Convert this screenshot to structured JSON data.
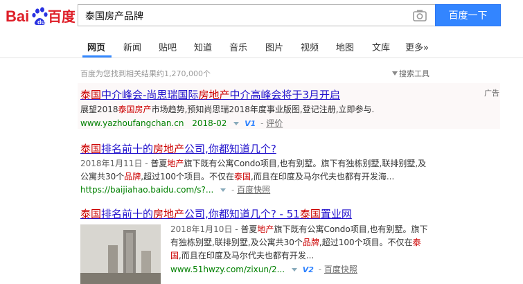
{
  "header": {
    "logo_text_left": "Bai",
    "logo_text_right": "百度",
    "query": "泰国房产品牌",
    "search_button": "百度一下"
  },
  "nav": {
    "items": [
      "网页",
      "新闻",
      "贴吧",
      "知道",
      "音乐",
      "图片",
      "视频",
      "地图",
      "文库",
      "更多»"
    ],
    "active": "网页"
  },
  "results_info": {
    "count_text": "百度为您找到相关结果约1,270,000个",
    "tools_label": "搜索工具"
  },
  "ad": {
    "label": "广告",
    "title_parts": [
      {
        "t": "泰国",
        "hl": true
      },
      {
        "t": "中介峰会-尚思瑞国际",
        "hl": false
      },
      {
        "t": "房地产",
        "hl": true
      },
      {
        "t": "中介高峰会将于3月开启",
        "hl": false
      }
    ],
    "abstract_parts": [
      {
        "t": "展望2018",
        "hl": false
      },
      {
        "t": "泰国房产",
        "hl": true
      },
      {
        "t": "市场趋势,预知尚思瑞2018年度事业版图,登记注册,立即参与.",
        "hl": false
      }
    ],
    "url": "www.yazhoufangchan.cn",
    "date": "2018-02",
    "badge": "V1",
    "eval": "评价"
  },
  "results": [
    {
      "title_parts": [
        {
          "t": "泰国",
          "hl": true
        },
        {
          "t": "排名前十的",
          "hl": false
        },
        {
          "t": "房地产",
          "hl": true
        },
        {
          "t": "公司,你都知道几个?",
          "hl": false
        }
      ],
      "line1_parts": [
        {
          "t": "2018年1月11日 - ",
          "hl": false,
          "date": true
        },
        {
          "t": "普夏",
          "hl": false
        },
        {
          "t": "地产",
          "hl": true
        },
        {
          "t": "旗下既有公寓Condo项目,也有别墅。旗下有独栋别墅,联排别墅,及",
          "hl": false
        }
      ],
      "line2_parts": [
        {
          "t": "公寓共30个",
          "hl": false
        },
        {
          "t": "品牌",
          "hl": true
        },
        {
          "t": ",超过100个项目。不仅在",
          "hl": false
        },
        {
          "t": "泰国",
          "hl": true
        },
        {
          "t": ",而且在印度及马尔代夫也都有开发海...",
          "hl": false
        }
      ],
      "url": "https://baijiahao.baidu.com/s?...",
      "cache": "百度快照"
    },
    {
      "title_parts": [
        {
          "t": "泰国",
          "hl": true
        },
        {
          "t": "排名前十的",
          "hl": false
        },
        {
          "t": "房地产",
          "hl": true
        },
        {
          "t": "公司,你都知道几个? - 51",
          "hl": false
        },
        {
          "t": "泰国",
          "hl": true
        },
        {
          "t": "置业网",
          "hl": false
        }
      ],
      "line1_parts": [
        {
          "t": "2018年1月10日 - ",
          "hl": false,
          "date": true
        },
        {
          "t": "普夏",
          "hl": false
        },
        {
          "t": "地产",
          "hl": true
        },
        {
          "t": "旗下既有公寓Condo项目,也有别墅。旗下",
          "hl": false
        }
      ],
      "line2_parts": [
        {
          "t": "有独栋别墅,联排别墅,及公寓共30个",
          "hl": false
        },
        {
          "t": "品牌",
          "hl": true
        },
        {
          "t": ",超过100个项目。不仅在",
          "hl": false
        },
        {
          "t": "泰",
          "hl": true
        }
      ],
      "line3_parts": [
        {
          "t": "国",
          "hl": true
        },
        {
          "t": ",而且在印度及马尔代夫也都有开发...",
          "hl": false
        }
      ],
      "url": "www.51hwzy.com/zixun/2...",
      "badge": "V2",
      "cache": "百度快照"
    }
  ]
}
